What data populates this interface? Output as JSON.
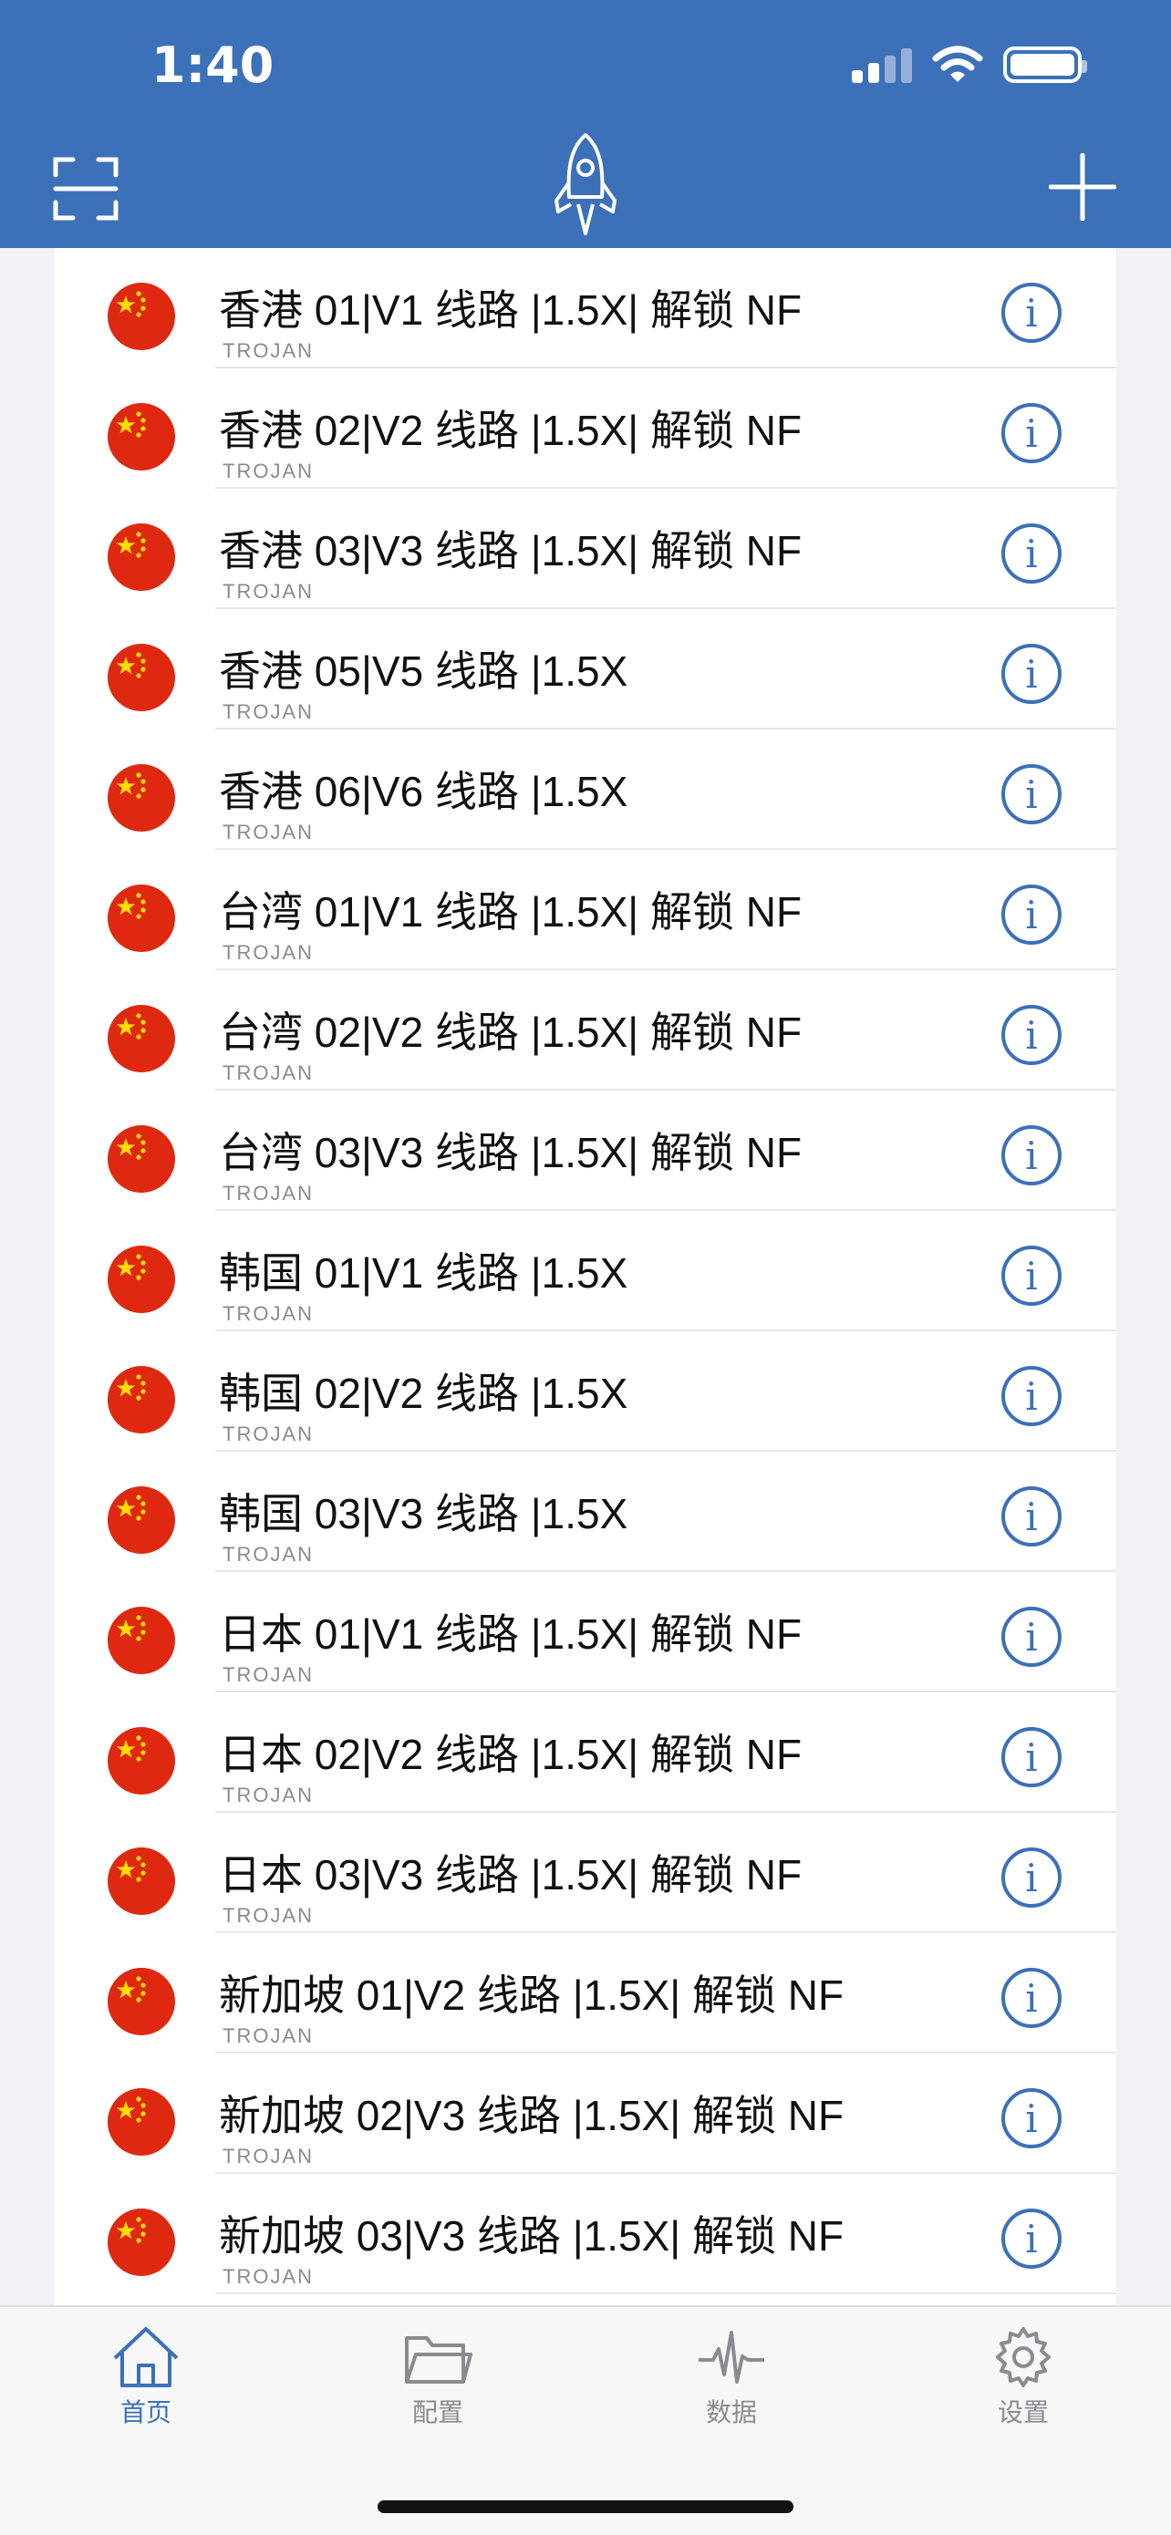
{
  "status": {
    "time": "1:40"
  },
  "colors": {
    "accent": "#3c70b9",
    "flag_red": "#de2910",
    "flag_star": "#ffde00"
  },
  "nav": {
    "left_icon": "scan-icon",
    "center_icon": "rocket-icon",
    "right_icon": "plus-icon"
  },
  "servers": [
    {
      "name": "香港 01|V1 线路 |1.5X| 解锁 NF",
      "protocol": "TROJAN"
    },
    {
      "name": "香港 02|V2 线路 |1.5X| 解锁 NF",
      "protocol": "TROJAN"
    },
    {
      "name": "香港 03|V3 线路 |1.5X| 解锁 NF",
      "protocol": "TROJAN"
    },
    {
      "name": "香港 05|V5 线路 |1.5X",
      "protocol": "TROJAN"
    },
    {
      "name": "香港 06|V6 线路 |1.5X",
      "protocol": "TROJAN"
    },
    {
      "name": "台湾 01|V1 线路 |1.5X| 解锁 NF",
      "protocol": "TROJAN"
    },
    {
      "name": "台湾 02|V2 线路 |1.5X| 解锁 NF",
      "protocol": "TROJAN"
    },
    {
      "name": "台湾 03|V3 线路 |1.5X| 解锁 NF",
      "protocol": "TROJAN"
    },
    {
      "name": "韩国 01|V1 线路 |1.5X",
      "protocol": "TROJAN"
    },
    {
      "name": "韩国 02|V2 线路 |1.5X",
      "protocol": "TROJAN"
    },
    {
      "name": "韩国 03|V3 线路 |1.5X",
      "protocol": "TROJAN"
    },
    {
      "name": "日本 01|V1 线路 |1.5X| 解锁 NF",
      "protocol": "TROJAN"
    },
    {
      "name": "日本 02|V2 线路 |1.5X| 解锁 NF",
      "protocol": "TROJAN"
    },
    {
      "name": "日本 03|V3 线路 |1.5X| 解锁 NF",
      "protocol": "TROJAN"
    },
    {
      "name": "新加坡 01|V2 线路 |1.5X| 解锁 NF",
      "protocol": "TROJAN"
    },
    {
      "name": "新加坡 02|V3 线路 |1.5X| 解锁 NF",
      "protocol": "TROJAN"
    },
    {
      "name": "新加坡 03|V3 线路 |1.5X| 解锁 NF",
      "protocol": "TROJAN"
    }
  ],
  "tabs": [
    {
      "label": "首页",
      "icon": "home-icon",
      "active": true
    },
    {
      "label": "配置",
      "icon": "folder-icon",
      "active": false
    },
    {
      "label": "数据",
      "icon": "activity-icon",
      "active": false
    },
    {
      "label": "设置",
      "icon": "gear-icon",
      "active": false
    }
  ]
}
